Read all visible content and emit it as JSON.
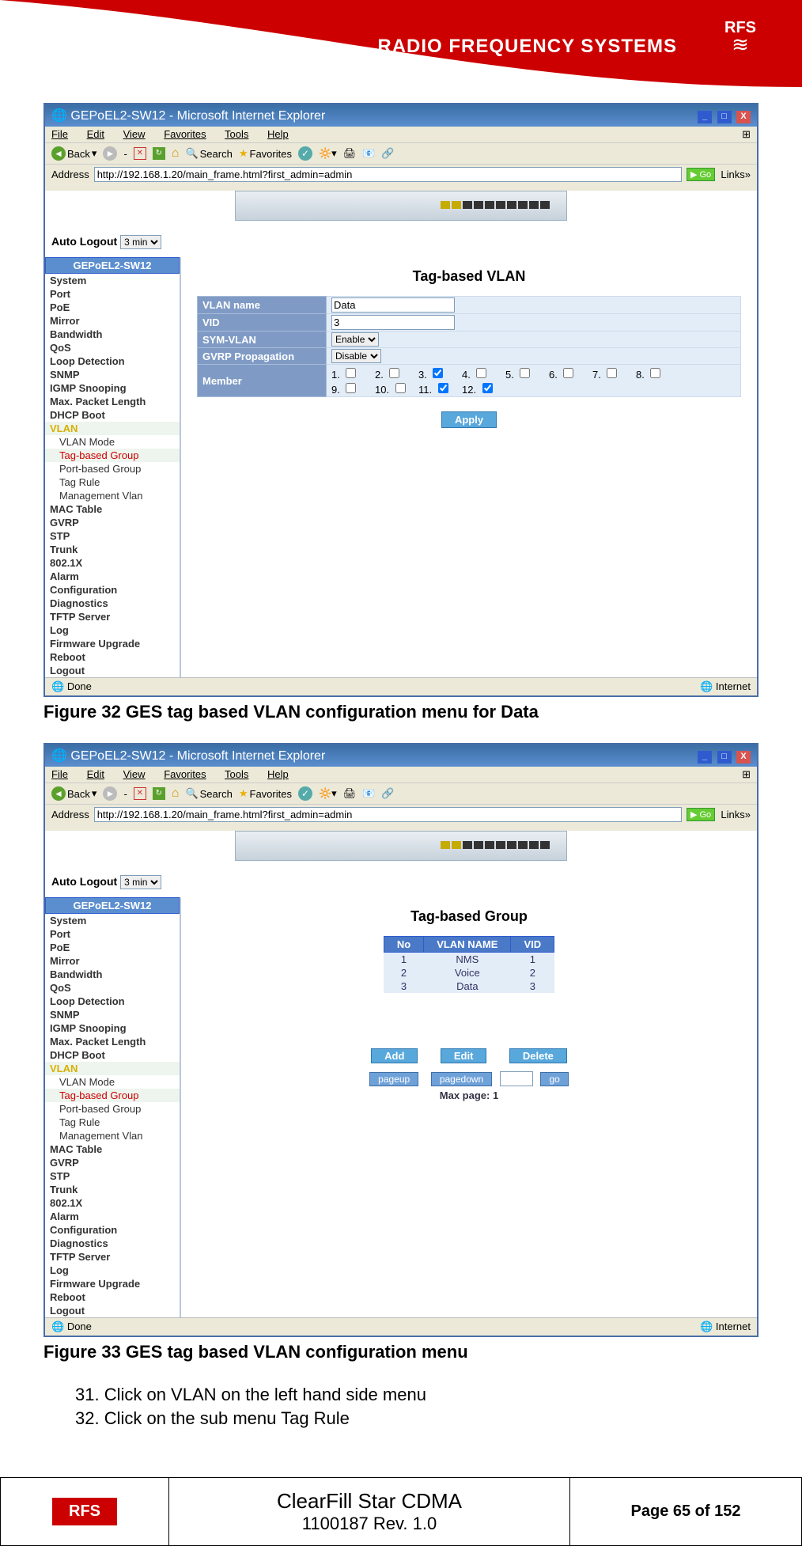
{
  "header": {
    "brand": "RADIO FREQUENCY SYSTEMS",
    "logo": "RFS"
  },
  "ie_common": {
    "title": "GEPoEL2-SW12 - Microsoft Internet Explorer",
    "menus": [
      "File",
      "Edit",
      "View",
      "Favorites",
      "Tools",
      "Help"
    ],
    "back": "Back",
    "search": "Search",
    "favorites": "Favorites",
    "addr_label": "Address",
    "addr_value": "http://192.168.1.20/main_frame.html?first_admin=admin",
    "go": "Go",
    "links": "Links",
    "status_done": "Done",
    "status_zone": "Internet",
    "winlogo": "⊞"
  },
  "auto_logout": {
    "label": "Auto Logout",
    "value": "3 min"
  },
  "sidebar": {
    "device": "GEPoEL2-SW12",
    "items": [
      "System",
      "Port",
      "PoE",
      "Mirror",
      "Bandwidth",
      "QoS",
      "Loop Detection",
      "SNMP",
      "IGMP Snooping",
      "Max. Packet Length",
      "DHCP Boot"
    ],
    "vlan": "VLAN",
    "vlan_sub": [
      "VLAN Mode",
      "Tag-based Group",
      "Port-based Group",
      "Tag Rule",
      "Management Vlan"
    ],
    "items2": [
      "MAC Table",
      "GVRP",
      "STP",
      "Trunk",
      "802.1X",
      "Alarm",
      "Configuration",
      "Diagnostics",
      "TFTP Server",
      "Log",
      "Firmware Upgrade",
      "Reboot",
      "Logout"
    ]
  },
  "fig32": {
    "title": "Tag-based VLAN",
    "rows": {
      "vlan_name_label": "VLAN name",
      "vlan_name_value": "Data",
      "vid_label": "VID",
      "vid_value": "3",
      "sym_label": "SYM-VLAN",
      "sym_value": "Enable",
      "gvrp_label": "GVRP Propagation",
      "gvrp_value": "Disable",
      "member_label": "Member",
      "members": [
        {
          "n": "1",
          "c": false
        },
        {
          "n": "2",
          "c": false
        },
        {
          "n": "3",
          "c": true
        },
        {
          "n": "4",
          "c": false
        },
        {
          "n": "5",
          "c": false
        },
        {
          "n": "6",
          "c": false
        },
        {
          "n": "7",
          "c": false
        },
        {
          "n": "8",
          "c": false
        },
        {
          "n": "9",
          "c": false
        },
        {
          "n": "10",
          "c": false
        },
        {
          "n": "11",
          "c": true
        },
        {
          "n": "12",
          "c": true
        }
      ]
    },
    "apply": "Apply",
    "caption": "Figure 32 GES tag based VLAN configuration menu for Data"
  },
  "fig33": {
    "title": "Tag-based Group",
    "headers": [
      "No",
      "VLAN NAME",
      "VID"
    ],
    "rows": [
      [
        "1",
        "NMS",
        "1"
      ],
      [
        "2",
        "Voice",
        "2"
      ],
      [
        "3",
        "Data",
        "3"
      ]
    ],
    "add": "Add",
    "edit": "Edit",
    "delete": "Delete",
    "pageup": "pageup",
    "pagedown": "pagedown",
    "go": "go",
    "maxpage": "Max page: 1",
    "caption": "Figure 33 GES tag based VLAN configuration menu"
  },
  "instructions": {
    "l1": "31. Click on VLAN on the left hand side menu",
    "l2": "32. Click on the sub menu Tag Rule"
  },
  "footer": {
    "logo": "RFS",
    "title": "ClearFill Star CDMA",
    "rev": "1100187 Rev. 1.0",
    "page": "Page 65 of 152"
  }
}
